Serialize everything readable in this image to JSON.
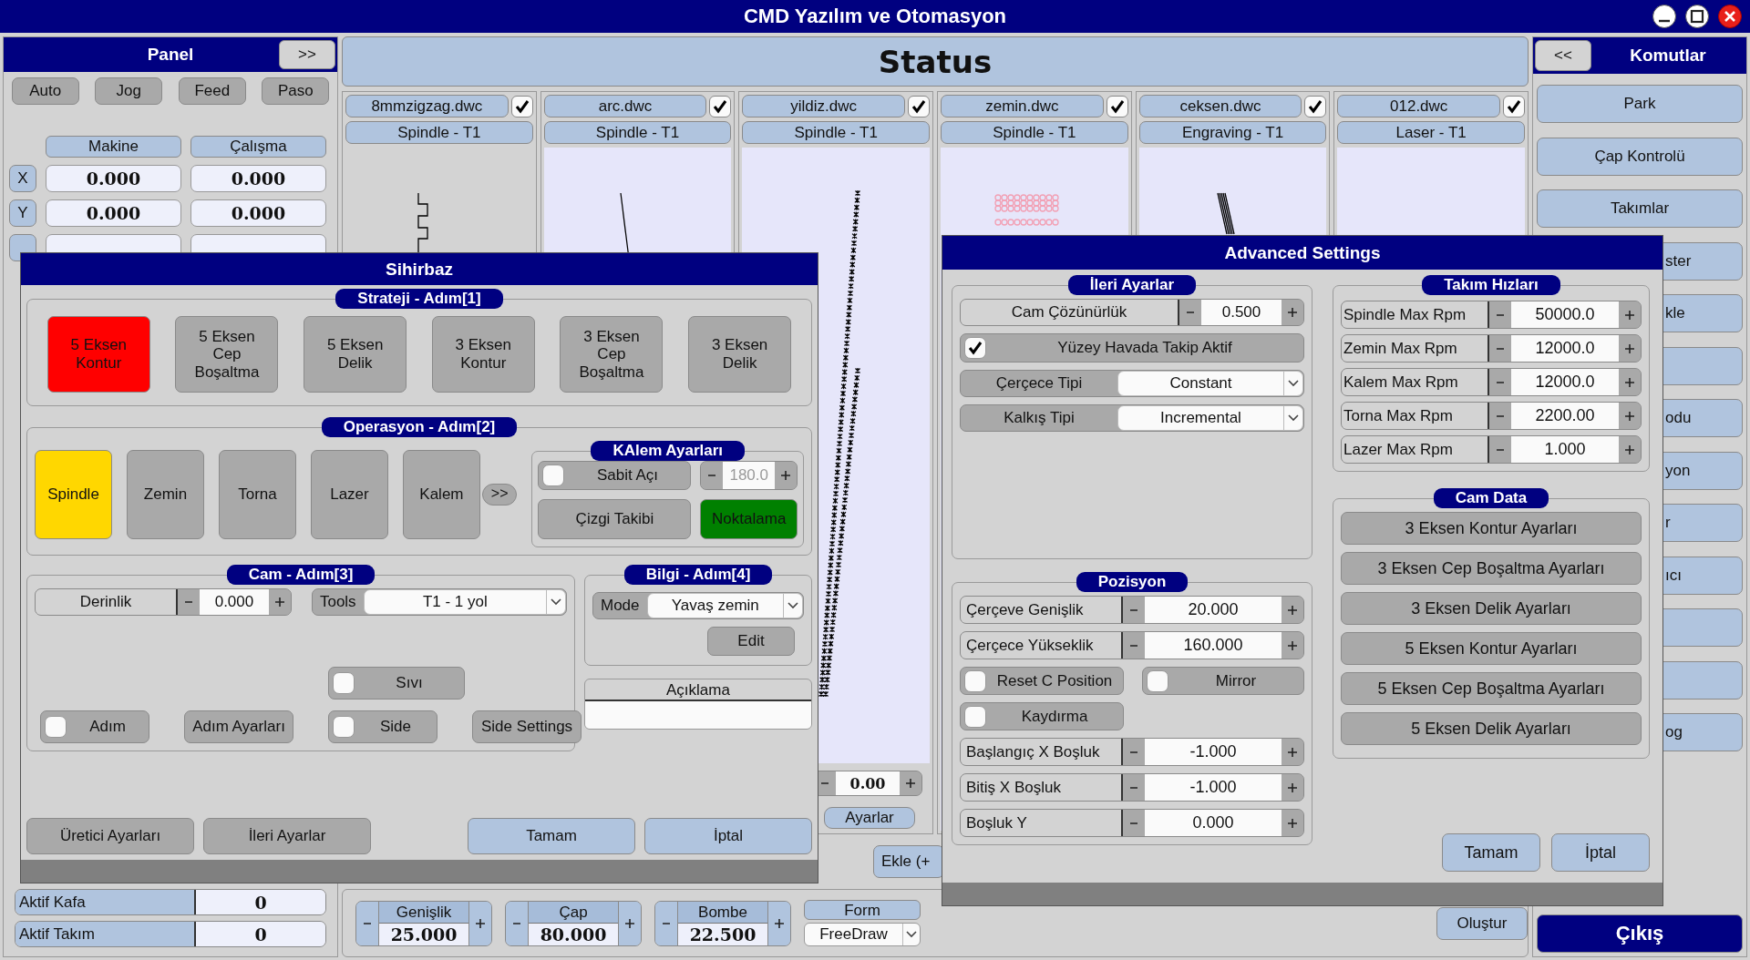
{
  "window": {
    "title": "CMD Yazılım ve Otomasyon"
  },
  "panel": {
    "title": "Panel",
    "toggle": ">>",
    "modes": [
      "Auto",
      "Jog",
      "Feed",
      "Paso"
    ],
    "columns": [
      "Makine",
      "Çalışma"
    ],
    "axes": [
      {
        "axis": "X",
        "machine": "0.000",
        "work": "0.000"
      },
      {
        "axis": "Y",
        "machine": "0.000",
        "work": "0.000"
      }
    ],
    "active": [
      {
        "label": "Aktif Kafa",
        "value": "0"
      },
      {
        "label": "Aktif Takım",
        "value": "0"
      }
    ]
  },
  "status": {
    "title": "Status",
    "files": [
      {
        "name": "8mmzigzag.dwc",
        "checked": true,
        "tool": "Spindle - T1",
        "selected": true
      },
      {
        "name": "arc.dwc",
        "checked": true,
        "tool": "Spindle - T1",
        "selected": false
      },
      {
        "name": "yildiz.dwc",
        "checked": true,
        "tool": "Spindle - T1",
        "selected": false,
        "footer": {
          "value": "0.00",
          "button": "Ayarlar"
        }
      },
      {
        "name": "zemin.dwc",
        "checked": true,
        "tool": "Spindle - T1",
        "selected": false
      },
      {
        "name": "ceksen.dwc",
        "checked": true,
        "tool": "Engraving - T1",
        "selected": false
      },
      {
        "name": "012.dwc",
        "checked": true,
        "tool": "Laser - T1",
        "selected": false
      }
    ],
    "add_button": "Ekle (+"
  },
  "shape": {
    "fields": [
      {
        "label": "Genişlik",
        "value": "25.000"
      },
      {
        "label": "Çap",
        "value": "80.000"
      },
      {
        "label": "Bombe",
        "value": "22.500"
      }
    ],
    "form": {
      "label": "Form",
      "value": "FreeDraw"
    },
    "create": "Oluştur"
  },
  "commands": {
    "toggle": "<<",
    "title": "Komutlar",
    "items": [
      {
        "kind": "full",
        "label": "Park"
      },
      {
        "kind": "full",
        "label": "Çap Kontrolü"
      },
      {
        "kind": "full",
        "label": "Takımlar"
      },
      {
        "kind": "covered",
        "label": "ster"
      },
      {
        "kind": "covered",
        "label": "kle"
      },
      {
        "kind": "covered"
      },
      {
        "kind": "covered",
        "label": "odu"
      },
      {
        "kind": "covered",
        "label": "yon"
      },
      {
        "kind": "covered",
        "label": "r"
      },
      {
        "kind": "covered",
        "label": "ıcı"
      },
      {
        "kind": "covered"
      },
      {
        "kind": "covered"
      },
      {
        "kind": "covered",
        "label": "og"
      }
    ],
    "exit": "Çıkış"
  },
  "wizard": {
    "title": "Sihirbaz",
    "strategy": {
      "title": "Strateji - Adım[1]",
      "options": [
        {
          "label": "5 Eksen\nKontur",
          "selected": true
        },
        {
          "label": "5 Eksen\nCep\nBoşaltma",
          "selected": false
        },
        {
          "label": "5 Eksen\nDelik",
          "selected": false
        },
        {
          "label": "3 Eksen\nKontur",
          "selected": false
        },
        {
          "label": "3 Eksen\nCep\nBoşaltma",
          "selected": false
        },
        {
          "label": "3 Eksen\nDelik",
          "selected": false
        }
      ]
    },
    "operation": {
      "title": "Operasyon - Adım[2]",
      "options": [
        {
          "label": "Spindle",
          "selected": true
        },
        {
          "label": "Zemin",
          "selected": false
        },
        {
          "label": "Torna",
          "selected": false
        },
        {
          "label": "Lazer",
          "selected": false
        },
        {
          "label": "Kalem",
          "selected": false
        }
      ],
      "more": ">>",
      "pen": {
        "title": "KAlem Ayarları",
        "fixed_angle": {
          "label": "Sabit Açı",
          "checked": false
        },
        "angle": {
          "value": "180.0",
          "disabled": true
        },
        "modes": [
          {
            "label": "Çizgi Takibi",
            "selected": false
          },
          {
            "label": "Noktalama",
            "selected": true
          }
        ]
      }
    },
    "cam": {
      "title": "Cam - Adım[3]",
      "depth": {
        "label": "Derinlik",
        "value": "0.000"
      },
      "tools": {
        "label": "Tools",
        "value": "T1 - 1 yol"
      },
      "rows": [
        [
          {
            "kind": "checkbox",
            "label": "Sıvı",
            "checked": false
          }
        ],
        [
          {
            "kind": "checkbox",
            "label": "Adım",
            "checked": false
          },
          {
            "kind": "button",
            "label": "Adım Ayarları"
          },
          {
            "kind": "checkbox",
            "label": "Side",
            "checked": false
          },
          {
            "kind": "button",
            "label": "Side Settings"
          }
        ]
      ]
    },
    "info": {
      "title": "Bilgi - Adım[4]",
      "mode": {
        "label": "Mode",
        "value": "Yavaş zemin"
      },
      "edit": "Edit"
    },
    "description": {
      "label": "Açıklama"
    },
    "buttons": [
      {
        "label": "Üretici Ayarları",
        "kind": "secondary"
      },
      {
        "label": "İleri Ayarlar",
        "kind": "secondary"
      },
      {
        "label": "Tamam",
        "kind": "primary"
      },
      {
        "label": "İptal",
        "kind": "primary"
      }
    ]
  },
  "advanced": {
    "title": "Advanced Settings",
    "settings": {
      "title": "İleri Ayarlar",
      "resolution": {
        "label": "Cam Çözünürlük",
        "value": "0.500"
      },
      "surface": {
        "label": "Yüzey Havada Takip Aktif",
        "checked": true
      },
      "combos": [
        {
          "label": "Çerçece Tipi",
          "value": "Constant"
        },
        {
          "label": "Kalkış Tipi",
          "value": "Incremental"
        }
      ]
    },
    "position": {
      "title": "Pozisyon",
      "rows": [
        {
          "kind": "spinner",
          "label": "Çerçeve Genişlik",
          "value": "20.000"
        },
        {
          "kind": "spinner",
          "label": "Çerçece Yükseklik",
          "value": "160.000"
        },
        {
          "kind": "checks",
          "items": [
            {
              "label": "Reset C Position",
              "checked": false
            },
            {
              "label": "Mirror",
              "checked": false
            }
          ]
        },
        {
          "kind": "checks",
          "items": [
            {
              "label": "Kaydırma",
              "checked": false
            }
          ]
        },
        {
          "kind": "spinner",
          "label": "Başlangıç X Boşluk",
          "value": "-1.000"
        },
        {
          "kind": "spinner",
          "label": "Bitiş X Boşluk",
          "value": "-1.000"
        },
        {
          "kind": "spinner",
          "label": "Boşluk Y",
          "value": "0.000"
        }
      ]
    },
    "speeds": {
      "title": "Takım Hızları",
      "rows": [
        {
          "label": "Spindle Max Rpm",
          "value": "50000.0"
        },
        {
          "label": "Zemin Max Rpm",
          "value": "12000.0"
        },
        {
          "label": "Kalem Max Rpm",
          "value": "12000.0"
        },
        {
          "label": "Torna Max Rpm",
          "value": "2200.00"
        },
        {
          "label": "Lazer Max Rpm",
          "value": "1.000"
        }
      ]
    },
    "cam_data": {
      "title": "Cam Data",
      "buttons": [
        "3 Eksen Kontur Ayarları",
        "3 Eksen Cep Boşaltma Ayarları",
        "3 Eksen Delik Ayarları",
        "5 Eksen Kontur Ayarları",
        "5 Eksen Cep Boşaltma Ayarları",
        "5 Eksen Delik Ayarları"
      ]
    },
    "buttons": [
      "Tamam",
      "İptal"
    ]
  }
}
